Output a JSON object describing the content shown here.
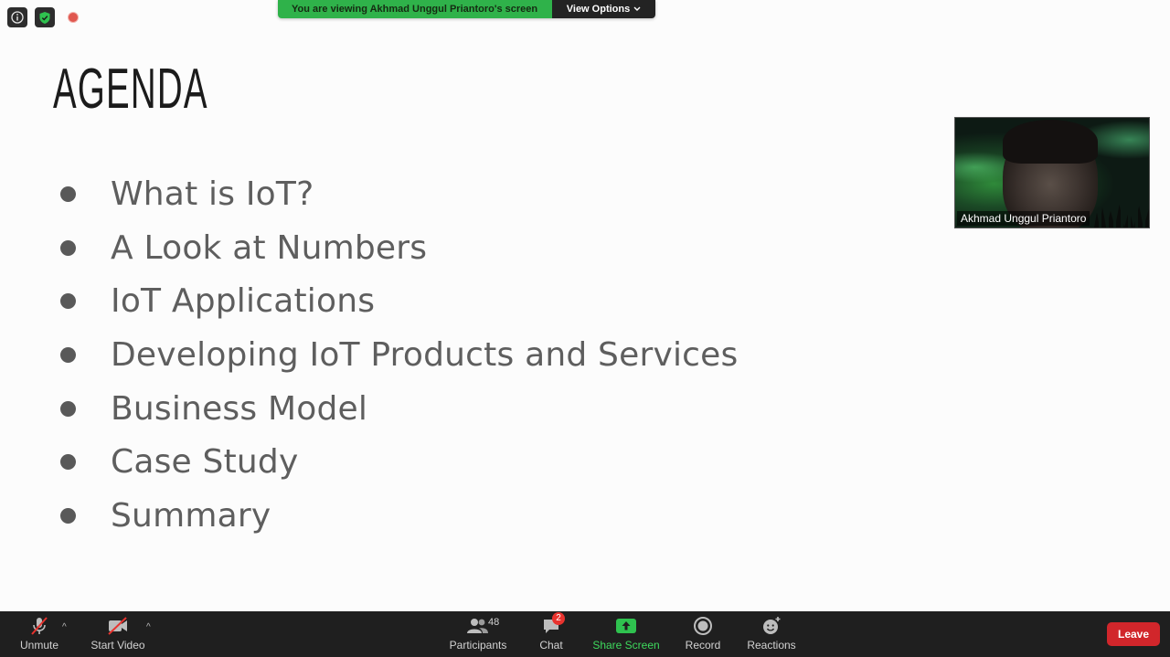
{
  "banner": {
    "viewing_text": "You are viewing Akhmad Unggul Priantoro's screen",
    "view_options_label": "View Options"
  },
  "top_icons": [
    "info-icon",
    "shield-check-icon",
    "recording-icon"
  ],
  "slide": {
    "title": "AGENDA",
    "items": [
      "What is IoT?",
      "A Look at Numbers",
      "IoT Applications",
      "Developing IoT Products and Services",
      "Business Model",
      "Case Study",
      "Summary"
    ]
  },
  "video": {
    "participant_name": "Akhmad Unggul Priantoro"
  },
  "toolbar": {
    "unmute_label": "Unmute",
    "start_video_label": "Start Video",
    "participants_label": "Participants",
    "participants_count": "48",
    "chat_label": "Chat",
    "chat_badge": "2",
    "share_screen_label": "Share Screen",
    "record_label": "Record",
    "reactions_label": "Reactions",
    "leave_label": "Leave"
  },
  "colors": {
    "banner_green": "#2fb24a",
    "share_green": "#3ed95d",
    "leave_red": "#d1262b",
    "toolbar_bg": "#1f1f1f"
  }
}
